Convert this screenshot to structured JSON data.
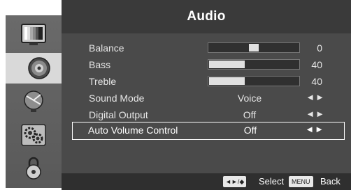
{
  "header": {
    "title": "Audio"
  },
  "sidebar": {
    "tabs": [
      {
        "icon": "picture-icon"
      },
      {
        "icon": "speaker-icon",
        "active": true
      },
      {
        "icon": "satellite-dish-icon"
      },
      {
        "icon": "gears-icon"
      },
      {
        "icon": "lock-icon"
      }
    ]
  },
  "menu": {
    "balance": {
      "label": "Balance",
      "value": "0",
      "level": 0.5
    },
    "bass": {
      "label": "Bass",
      "value": "40",
      "level": 0.4
    },
    "treble": {
      "label": "Treble",
      "value": "40",
      "level": 0.4
    },
    "sound_mode": {
      "label": "Sound Mode",
      "value": "Voice",
      "arrows": "◄►"
    },
    "digital_output": {
      "label": "Digital Output",
      "value": "Off",
      "arrows": "◄►"
    },
    "auto_volume_control": {
      "label": "Auto Volume Control",
      "value": "Off",
      "arrows": "◄►"
    }
  },
  "footer": {
    "nav_icon": "◄►/◆",
    "select_label": "Select",
    "menu_key": "MENU",
    "back_label": "Back"
  },
  "colors": {
    "panel": "#4a4a4a",
    "header": "#3a3a3a",
    "sidebar": "#606060",
    "active_tab": "#d9d9d9",
    "text": "#e6e6e6"
  }
}
